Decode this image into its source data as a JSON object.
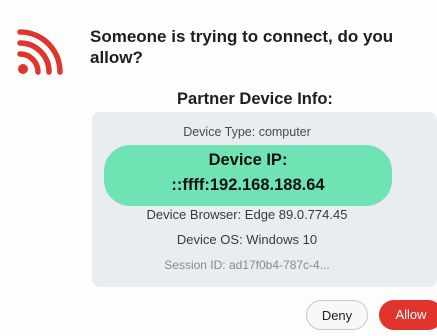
{
  "dialog": {
    "icon": "wifi-icon",
    "question": "Someone is trying to connect, do you allow?",
    "partner_title": "Partner Device Info:",
    "device": {
      "type": "Device Type: computer",
      "ip_label": "Device IP:",
      "ip_value": "::ffff:192.168.188.64",
      "browser": "Device Browser: Edge 89.0.774.45",
      "os": "Device OS: Windows 10",
      "session": "Session ID: ad17f0b4-787c-4..."
    },
    "buttons": {
      "deny": "Deny",
      "allow": "Allow"
    },
    "colors": {
      "accent_red": "#e0342d",
      "ip_highlight": "#6fe3b4",
      "card_background": "#e9ecf0"
    }
  }
}
